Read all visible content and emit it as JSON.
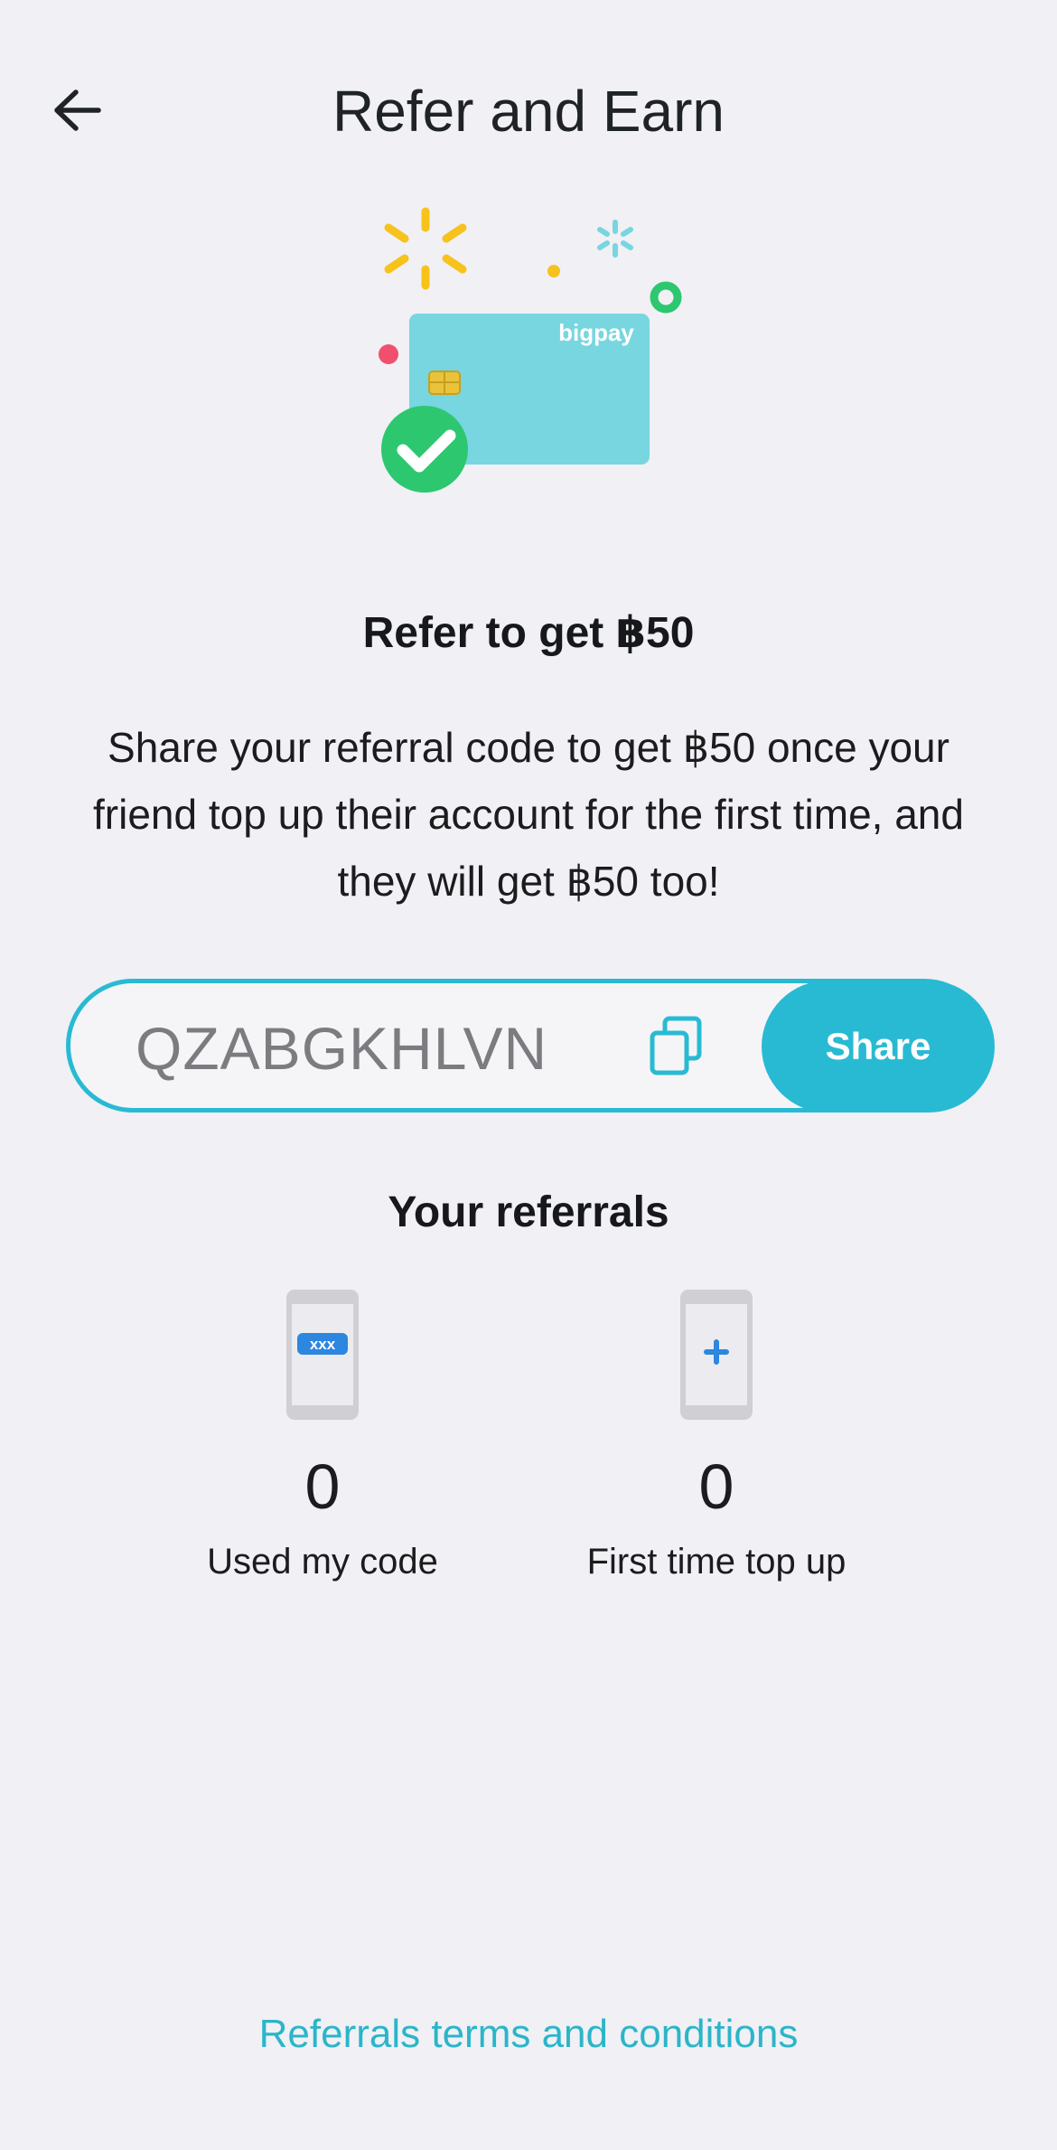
{
  "header": {
    "title": "Refer and Earn",
    "back_icon": "arrow-left-icon"
  },
  "hero": {
    "card_brand": "bigpay",
    "card_color": "#77d6e0",
    "check_color": "#2dc770"
  },
  "promo": {
    "heading": "Refer to get ฿50",
    "description": "Share your referral code to get ฿50 once your friend top up their account for the first time, and they will get ฿50 too!"
  },
  "referral_code": {
    "code": "QZABGKHLVN",
    "copy_icon": "copy-icon",
    "share_label": "Share"
  },
  "referrals": {
    "heading": "Your referrals",
    "stats": [
      {
        "icon": "phone-code-icon",
        "badge": "xxx",
        "count": "0",
        "label": "Used my code"
      },
      {
        "icon": "phone-plus-icon",
        "count": "0",
        "label": "First time top up"
      }
    ]
  },
  "footer": {
    "terms_link": "Referrals terms and conditions"
  },
  "colors": {
    "accent": "#29bad3",
    "background": "#f0f0f5",
    "link": "#2bb5c9"
  }
}
